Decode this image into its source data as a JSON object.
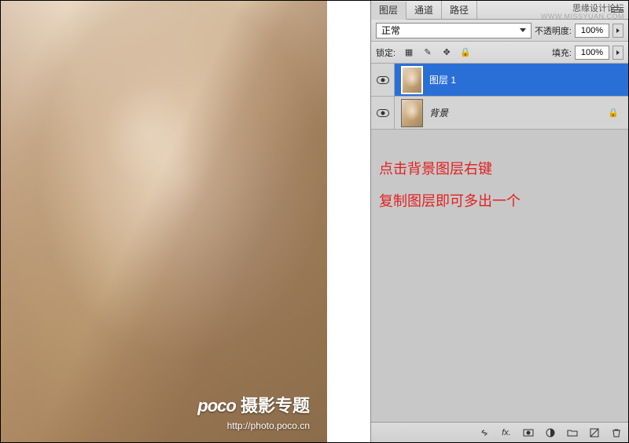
{
  "branding": {
    "name": "思缘设计论坛",
    "url": "WWW.MISSYUAN.COM"
  },
  "photo": {
    "watermark_main_prefix": "poco",
    "watermark_main_suffix": "摄影专题",
    "watermark_sub": "http://photo.poco.cn"
  },
  "panel": {
    "tabs": {
      "layers": "图层",
      "channels": "通道",
      "paths": "路径"
    },
    "blend_mode": "正常",
    "opacity_label": "不透明度:",
    "opacity_value": "100%",
    "lock_label": "锁定:",
    "fill_label": "填充:",
    "fill_value": "100%",
    "lock_icons": {
      "transparent": "▦",
      "brush": "✎",
      "move": "✥",
      "all": "🔒"
    }
  },
  "layers": [
    {
      "name": "图层 1",
      "locked": false,
      "selected": true
    },
    {
      "name": "背景",
      "locked": true,
      "selected": false
    }
  ],
  "instructions": {
    "line1": "点击背景图层右键",
    "line2": "复制图层即可多出一个"
  },
  "footer_icons": {
    "link": "⬤",
    "fx": "fx.",
    "mask": "◐",
    "adjust": "◑",
    "folder": "▢",
    "new": "▣",
    "trash": "🗑"
  }
}
